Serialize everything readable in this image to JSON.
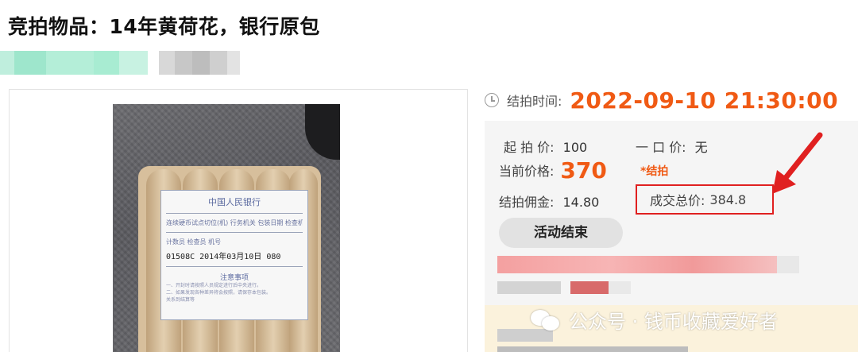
{
  "auction": {
    "title": "竞拍物品：14年黄荷花，银行原包"
  },
  "photo": {
    "label_title": "中国人民银行",
    "label_header_row": "连续硬币试点切位(机) 行务机关 包装日期 检查机",
    "label_header_row2": "计数员   检查员   机号",
    "label_handwritten": "01508C  2014年03月10日  080",
    "label_note_title": "注意事项",
    "label_note_1": "一、开封时请按照人员规定进行后中央进行。",
    "label_note_2": "二、如果发现各种差异将会按照，请保存本包装。",
    "label_note_3": "关系到结算等"
  },
  "timing": {
    "label": "结拍时间:",
    "value": "2022-09-10 21:30:00"
  },
  "pricing": {
    "start_label": "起 拍 价:",
    "start_value": "100",
    "buyout_label": "一 口 价:",
    "buyout_value": "无",
    "current_label": "当前价格:",
    "current_value": "370",
    "sold_tag": "*结拍",
    "commission_label": "结拍佣金:",
    "commission_value": "14.80",
    "total_label": "成交总价:",
    "total_value": "384.8"
  },
  "status_button": {
    "label": "活动结束"
  },
  "watermark": {
    "text": "公众号 · 钱币收藏爱好者"
  },
  "colors": {
    "accent_orange": "#f05a14",
    "highlight_red": "#e02020",
    "panel_bg": "#f5f5f5"
  },
  "icons": {
    "clock": "clock-icon",
    "arrow": "red-arrow-icon",
    "wechat": "wechat-icon"
  }
}
